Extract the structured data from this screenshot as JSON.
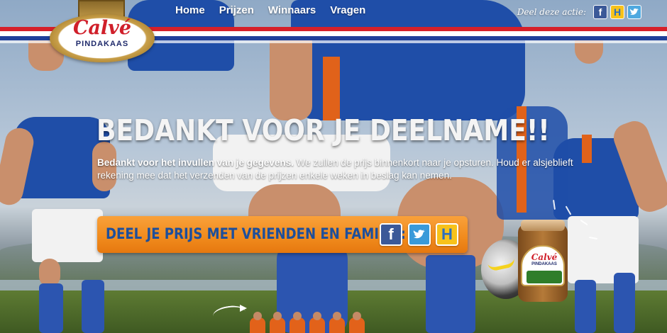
{
  "nav": {
    "items": [
      "Home",
      "Prijzen",
      "Winnaars",
      "Vragen"
    ]
  },
  "share_top": {
    "label": "Deel deze actie:",
    "icons": [
      "facebook-icon",
      "hyves-icon",
      "twitter-icon"
    ]
  },
  "logo": {
    "name": "Calvé",
    "subtitle": "PINDAKAAS"
  },
  "main": {
    "heading": "BEDANKT VOOR JE DEELNAME!!",
    "intro_bold": "Bedankt voor het invullen van je gegevens.",
    "intro_rest": " We zullen de prijs binnenkort naar je opsturen. Houd er alsjeblieft rekening mee dat het verzenden van de prijzen enkele weken in beslag kan nemen."
  },
  "share_bar": {
    "label": "DEEL JE PRIJS MET VRIENDEN EN FAMILIE:",
    "icons": [
      "facebook-icon",
      "twitter-icon",
      "hyves-icon"
    ]
  },
  "product": {
    "jar_name": "Calvé",
    "jar_sub": "PINDAKAAS"
  },
  "colors": {
    "flag_red": "#d6202a",
    "flag_blue": "#1f3f9a",
    "accent_orange": "#f08a1c",
    "brand_blue": "#1d4f9c",
    "facebook": "#3b5998",
    "twitter": "#3a9ad9",
    "hyves": "#f7c21b"
  }
}
